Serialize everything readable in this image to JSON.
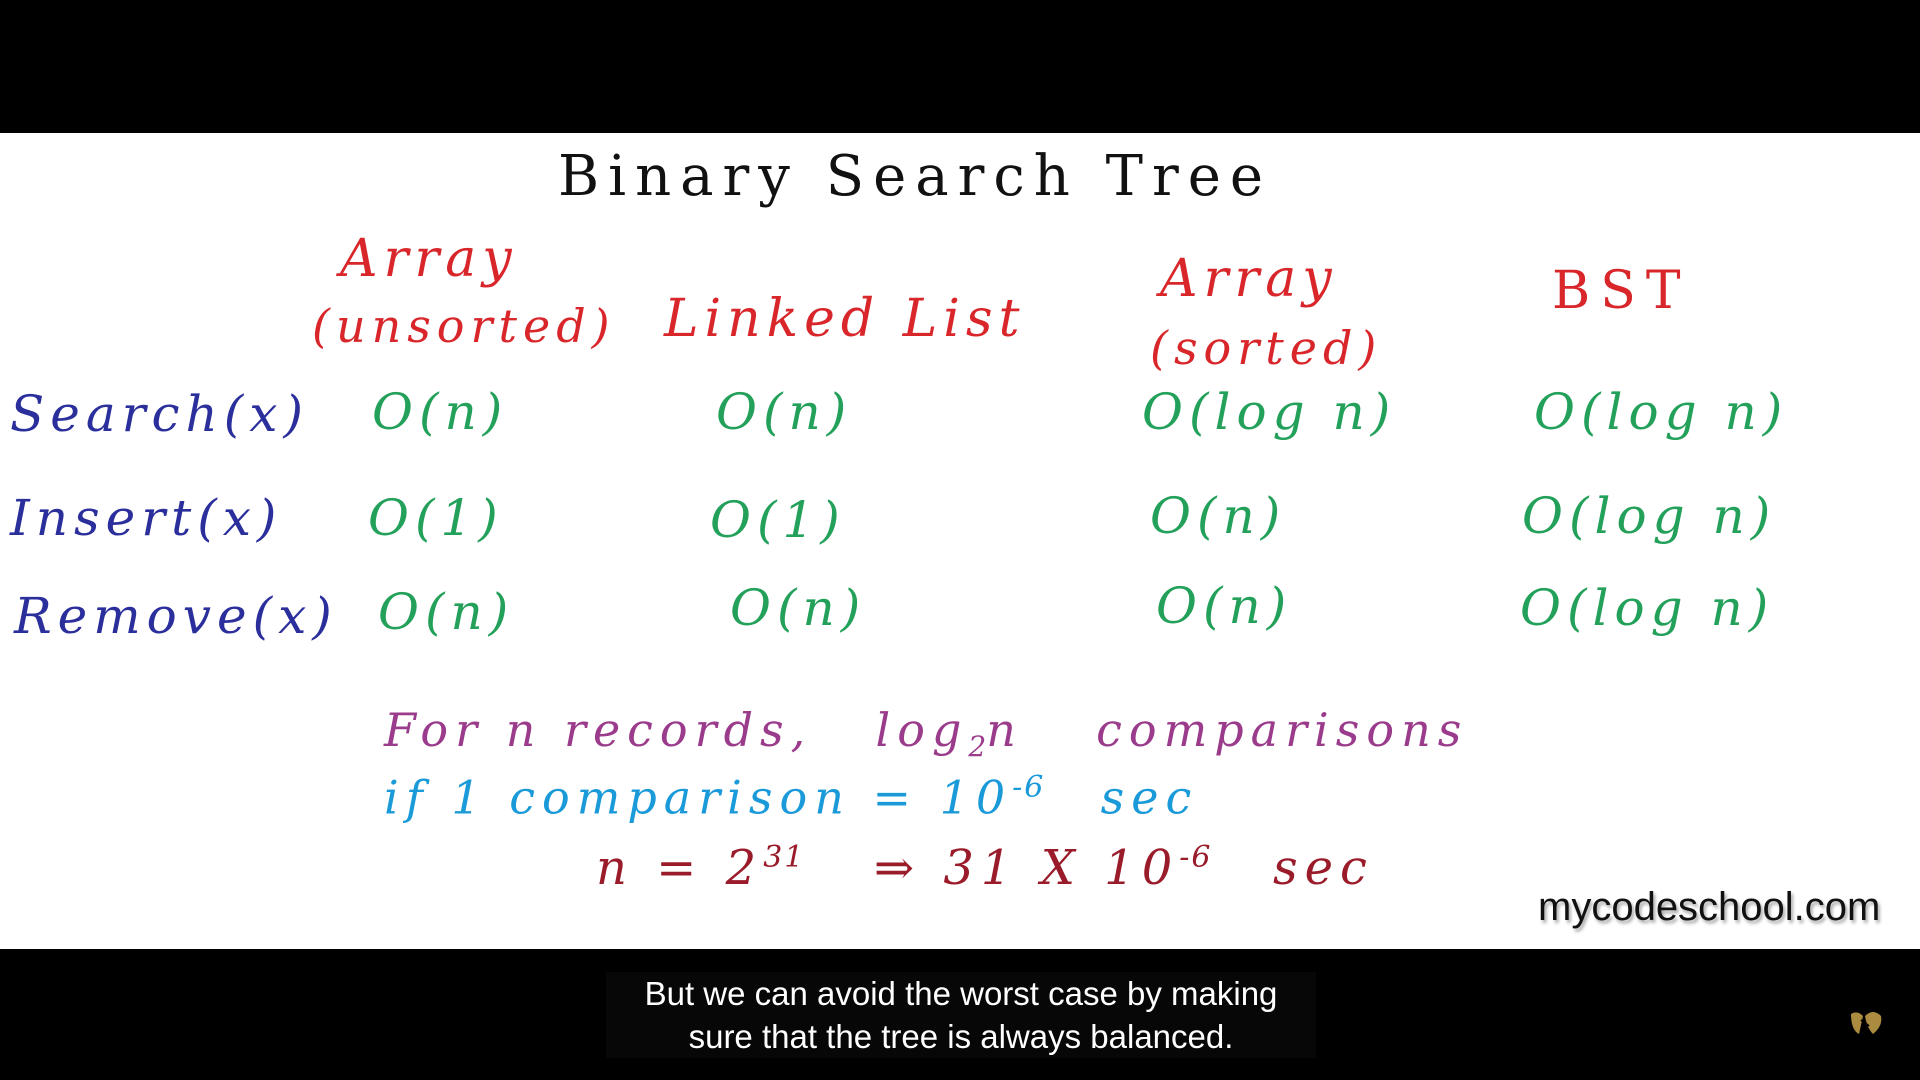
{
  "slide": {
    "title": "Binary Search Tree",
    "columns": [
      {
        "head": "Array",
        "sub": "(unsorted)"
      },
      {
        "head": "Linked List",
        "sub": ""
      },
      {
        "head": "Array",
        "sub": "(sorted)"
      },
      {
        "head": "BST",
        "sub": ""
      }
    ],
    "rows": [
      {
        "label": "Search(x)",
        "cells": [
          "O(n)",
          "O(n)",
          "O(log n)",
          "O(log n)"
        ]
      },
      {
        "label": "Insert(x)",
        "cells": [
          "O(1)",
          "O(1)",
          "O(n)",
          "O(log n)"
        ]
      },
      {
        "label": "Remove(x)",
        "cells": [
          "O(n)",
          "O(n)",
          "O(n)",
          "O(log n)"
        ]
      }
    ],
    "notes": {
      "line1_a": "For n records,",
      "line1_log": "log",
      "line1_base": "2",
      "line1_b": "n",
      "line1_c": "comparisons",
      "line2_a": "if 1 comparison = 10",
      "line2_exp": "-6",
      "line2_b": "sec",
      "line3_a": "n = 2",
      "line3_exp": "31",
      "line3_b": "⇒ 31 X 10",
      "line3_exp2": "-6",
      "line3_c": "sec"
    },
    "watermark": "mycodeschool.com",
    "colors": {
      "title": "#111111",
      "column_headers": "#d8262a",
      "row_labels": "#2b2f9c",
      "cells": "#23a05a",
      "note1": "#9b3b8b",
      "note2": "#1a9ad8",
      "note3": "#9a1b2a"
    }
  },
  "captions": {
    "line1": "But we can avoid the worst case by making",
    "line2": "sure that the tree is always balanced."
  },
  "player": {
    "channel_icon": "channel-watermark-icon"
  }
}
